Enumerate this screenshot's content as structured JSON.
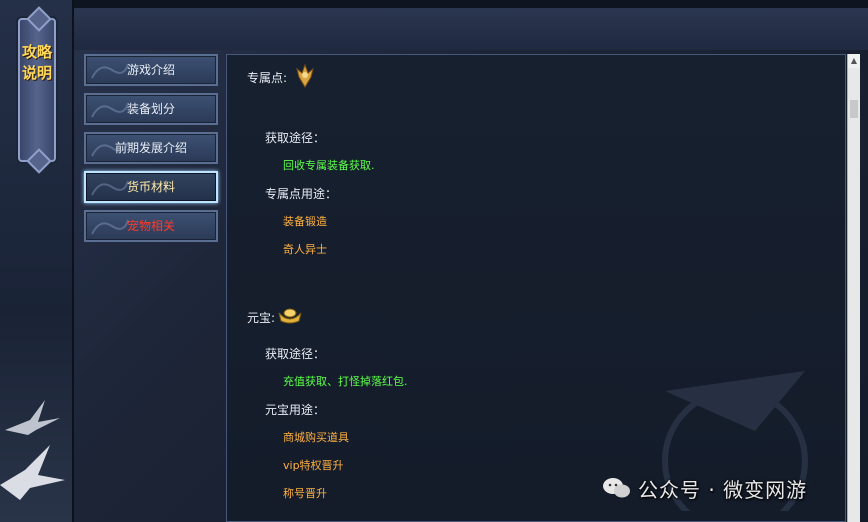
{
  "sidebar": {
    "title": "攻略说明"
  },
  "menu": {
    "items": [
      {
        "label": "游戏介绍"
      },
      {
        "label": "装备划分"
      },
      {
        "label": "前期发展介绍"
      },
      {
        "label": "货币材料"
      },
      {
        "label": "宠物相关"
      }
    ]
  },
  "content": {
    "section1": {
      "title": "专属点:",
      "acquire_label": "获取途径：",
      "acquire_text": "回收专属装备获取.",
      "use_label": "专属点用途：",
      "uses": [
        "装备锻造",
        "奇人异士"
      ]
    },
    "section2": {
      "title": "元宝:",
      "acquire_label": "获取途径：",
      "acquire_text": "充值获取、打怪掉落红包.",
      "use_label": "元宝用途：",
      "uses": [
        "商城购买道具",
        "vip特权晋升",
        "称号晋升"
      ]
    }
  },
  "watermark": {
    "text": "公众号 · 微变网游"
  },
  "colors": {
    "green_text": "#5dff4a",
    "orange_text": "#ffb040",
    "alert_text": "#ff3b2a",
    "title_gold": "#ffd85a"
  },
  "icons": {
    "section1": "trident-emblem-icon",
    "section2": "gold-ingot-icon",
    "watermark": "wechat-icon"
  }
}
